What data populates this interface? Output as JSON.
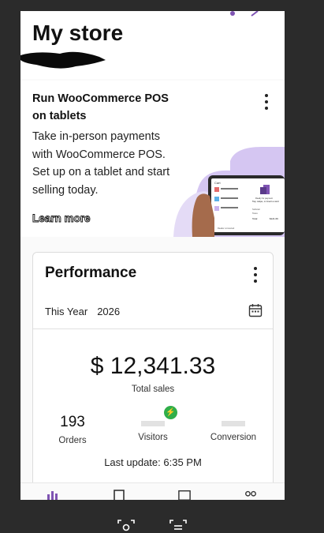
{
  "header": {
    "title": "My store"
  },
  "promo": {
    "title": "Run WooCommerce POS on tablets",
    "body": "Take in-person payments with WooCommerce POS. Set up on a tablet and start selling today.",
    "link": "Learn more",
    "mockup": {
      "cart": "Cart",
      "ready": "Ready for payment",
      "instruction": "Tap, swipe, or insert a card",
      "subtotal": "Subtotal",
      "taxes": "Taxes",
      "total_label": "Total",
      "total_value": "$121.69",
      "reader": "Reader connected"
    }
  },
  "performance": {
    "title": "Performance",
    "range_label": "This Year",
    "range_year": "2026",
    "total_sales_value": "$ 12,341.33",
    "total_sales_label": "Total sales",
    "stats": [
      {
        "value": "193",
        "label": "Orders"
      },
      {
        "value": "",
        "label": "Visitors"
      },
      {
        "value": "",
        "label": "Conversion"
      }
    ],
    "last_update": "Last update: 6:35 PM"
  },
  "icons": {
    "menu": "more-vertical-icon",
    "calendar": "calendar-icon",
    "jetpack": "lightning-bolt-icon",
    "nav": [
      "stats-icon",
      "orders-icon",
      "products-icon",
      "menu-icon"
    ],
    "system": [
      "lens-icon",
      "screenshot-text-icon"
    ]
  },
  "colors": {
    "accent": "#7f54b3",
    "jetpack_green": "#2fae49",
    "promo_blob": "#d5c6f2"
  }
}
